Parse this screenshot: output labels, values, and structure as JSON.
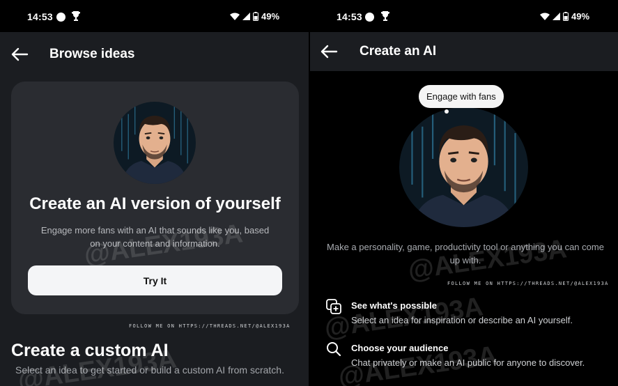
{
  "left": {
    "status": {
      "time": "14:53",
      "battery": "49%"
    },
    "appbar": {
      "title": "Browse ideas"
    },
    "card": {
      "title": "Create an AI version of yourself",
      "subtitle": "Engage more fans with an AI that sounds like you, based on your content and information.",
      "button": "Try It"
    },
    "follow_text": "FOLLOW ME ON HTTPS://THREADS.NET/@ALEX193A",
    "custom": {
      "title": "Create a custom AI",
      "subtitle": "Select an idea to get started or build a custom AI from scratch."
    },
    "watermark": "@ALEX193A"
  },
  "right": {
    "status": {
      "time": "14:53",
      "battery": "49%"
    },
    "appbar": {
      "title": "Create an AI"
    },
    "bubble": "Engage with fans",
    "description": "Make a personality, game, productivity tool or anything you can come up with.",
    "follow_text": "FOLLOW ME ON HTTPS://THREADS.NET/@ALEX193A",
    "features": [
      {
        "icon": "add-copy-icon",
        "title": "See what's possible",
        "desc": "Select an idea for inspiration or describe an AI yourself."
      },
      {
        "icon": "search-icon",
        "title": "Choose your audience",
        "desc": "Chat privately or make an AI public for anyone to discover."
      }
    ],
    "watermark": "@ALEX193A"
  }
}
